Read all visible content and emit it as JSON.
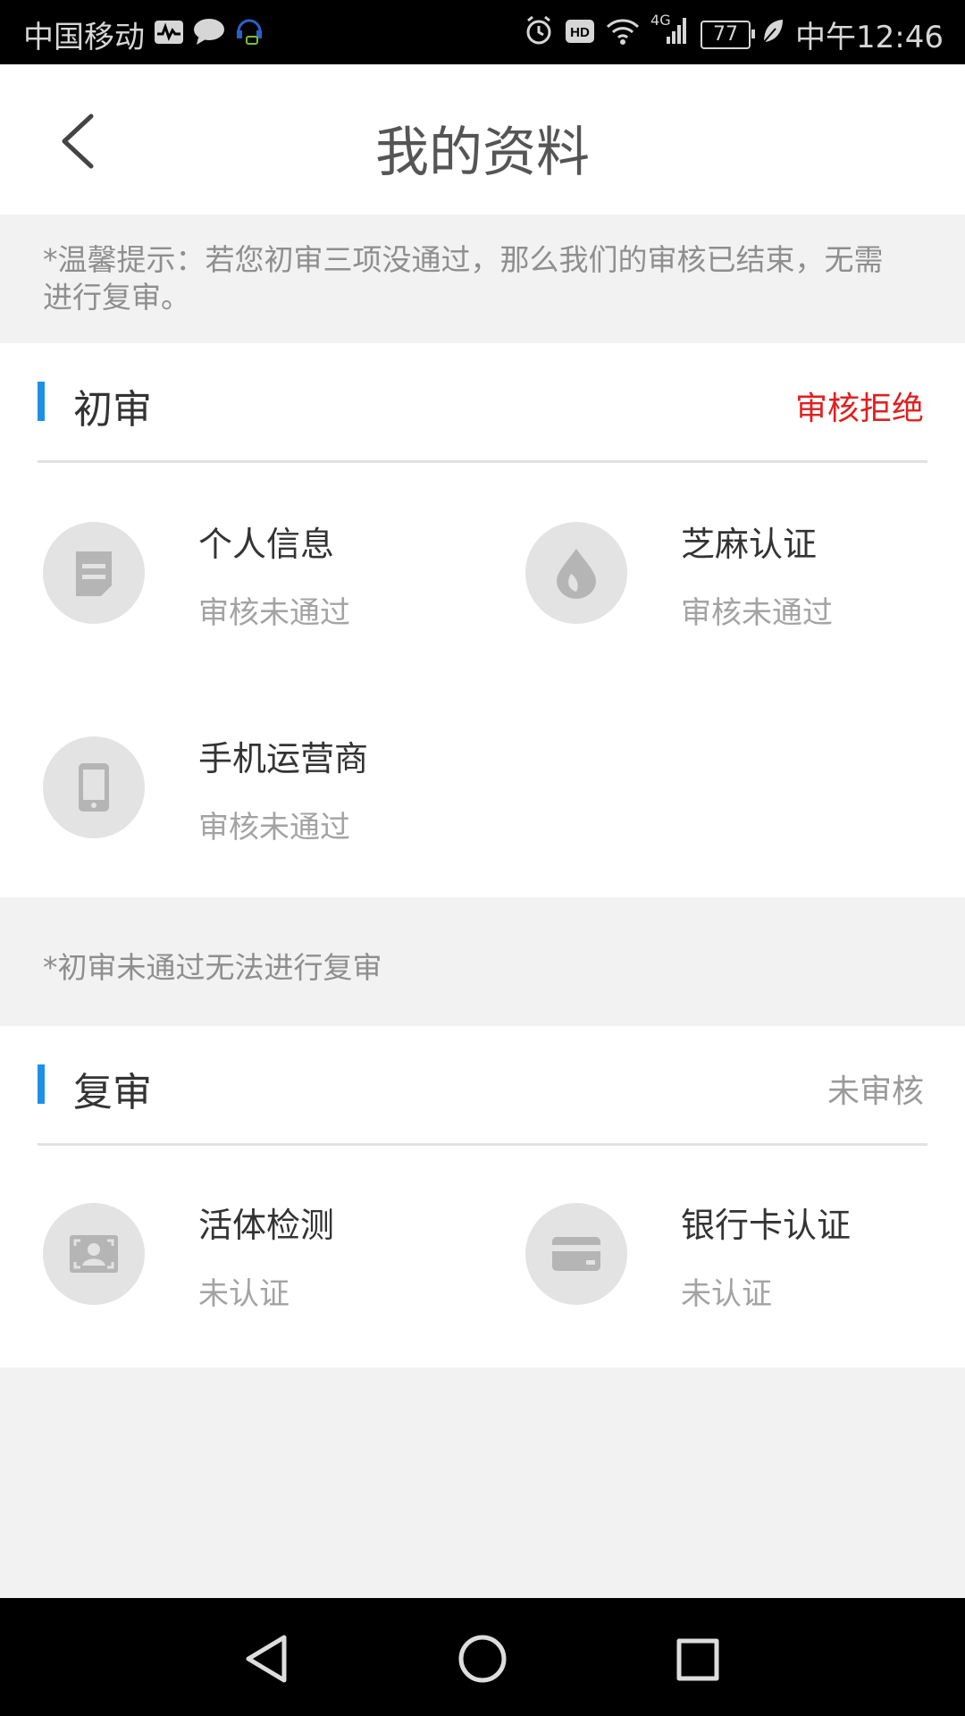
{
  "status_bar": {
    "carrier": "中国移动",
    "network": "4G",
    "battery": "77",
    "time": "中午12:46"
  },
  "header": {
    "title": "我的资料"
  },
  "notice": "*温馨提示：若您初审三项没通过，那么我们的审核已结束，无需进行复审。",
  "initial_review": {
    "title": "初审",
    "status": "审核拒绝",
    "status_color": "#e02020",
    "items": [
      {
        "label": "个人信息",
        "state": "审核未通过",
        "icon": "document-icon"
      },
      {
        "label": "芝麻认证",
        "state": "审核未通过",
        "icon": "sesame-drop-icon"
      },
      {
        "label": "手机运营商",
        "state": "审核未通过",
        "icon": "phone-icon"
      }
    ]
  },
  "review_note": "*初审未通过无法进行复审",
  "second_review": {
    "title": "复审",
    "status": "未审核",
    "status_color": "#9a9a9a",
    "items": [
      {
        "label": "活体检测",
        "state": "未认证",
        "icon": "face-scan-icon"
      },
      {
        "label": "银行卡认证",
        "state": "未认证",
        "icon": "bank-card-icon"
      }
    ]
  },
  "colors": {
    "accent_bar": "#1e90e6",
    "icon_bg": "#e3e3e3",
    "icon_fg": "#b5b5b5"
  }
}
